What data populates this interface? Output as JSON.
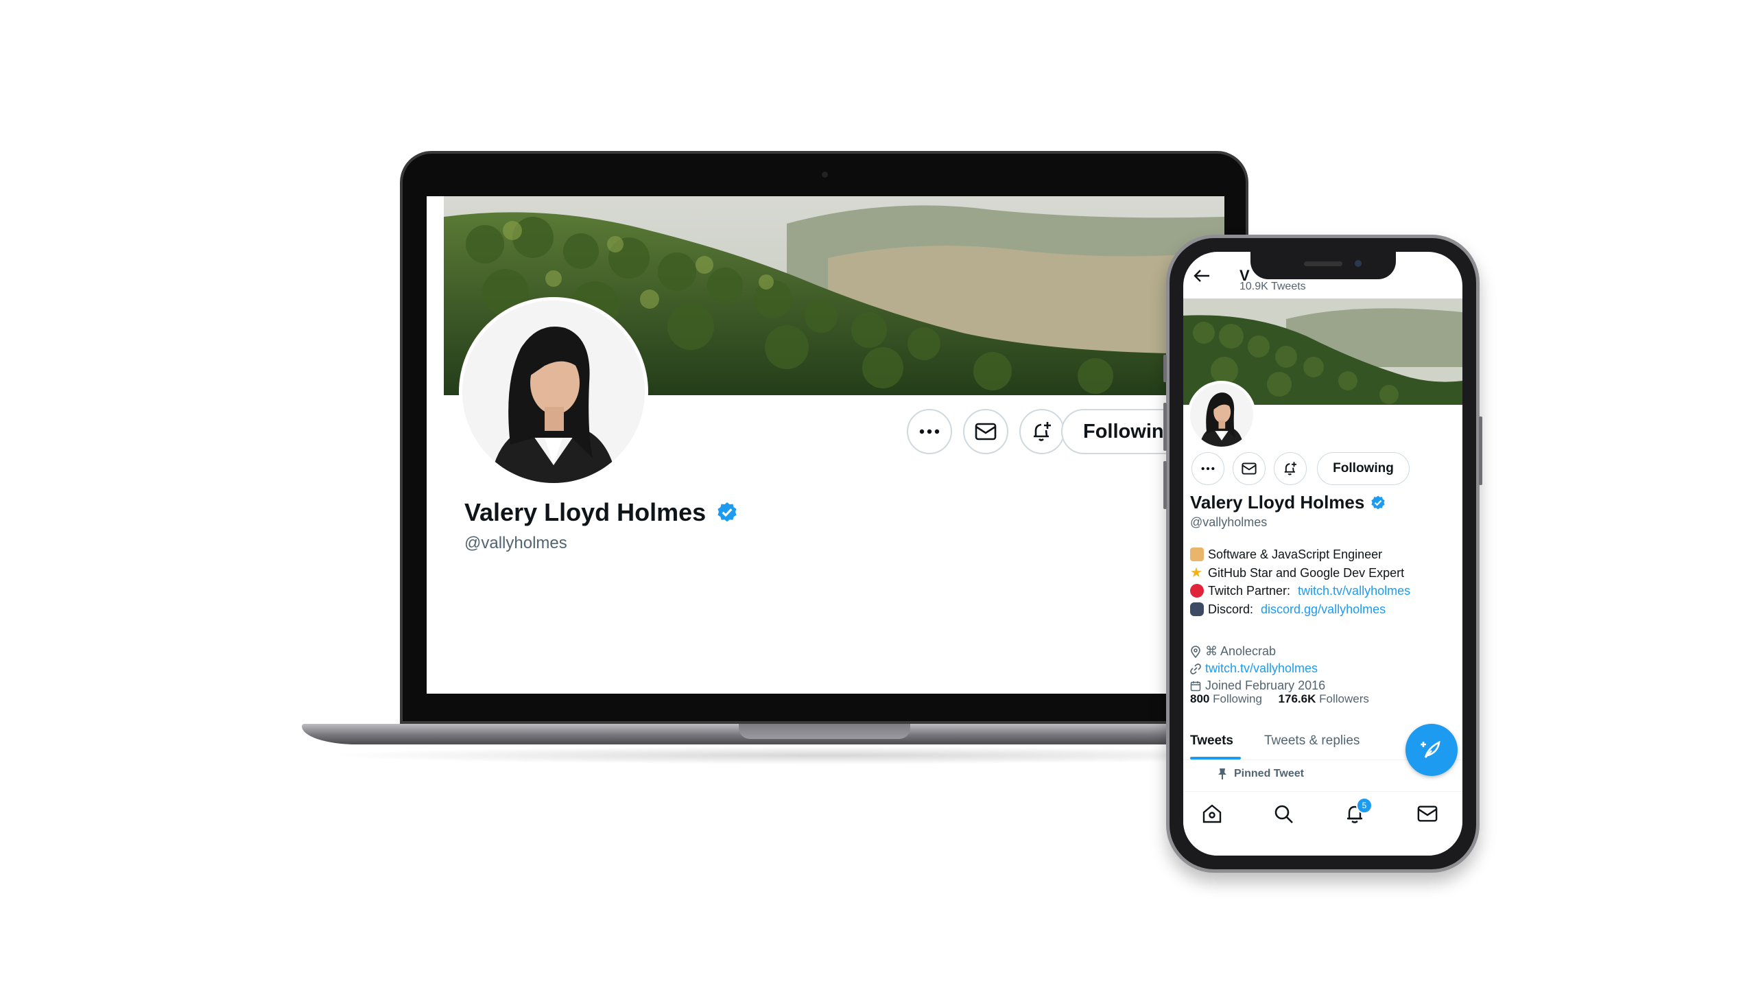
{
  "colors": {
    "accent": "#1d9bf0",
    "text_primary": "#0f1419",
    "text_secondary": "#536471",
    "border": "#cfd9de"
  },
  "profile": {
    "name": "Valery Lloyd Holmes",
    "handle": "@vallyholmes",
    "verified_icon": "verified-badge-icon",
    "following_label": "Following"
  },
  "laptop": {
    "more_icon": "more-dots-icon",
    "message_icon": "mail-icon",
    "notify_icon": "bell-plus-icon",
    "following_label": "Following"
  },
  "phone": {
    "header": {
      "title_fragment": "V",
      "tweets_count": "10.9K Tweets",
      "back_icon": "back-arrow-icon"
    },
    "bio": {
      "line1": "Software & JavaScript Engineer",
      "line2": "GitHub Star and Google Dev Expert",
      "line3_label": "Twitch Partner: ",
      "line3_link": "twitch.tv/vallyholmes",
      "line4_label": "Discord: ",
      "line4_link": "discord.gg/vallyholmes"
    },
    "meta": {
      "location": "⌘ Anolecrab",
      "website": "twitch.tv/vallyholmes",
      "joined": "Joined February 2016"
    },
    "stats": {
      "following_count": "800",
      "following_label": "Following",
      "followers_count": "176.6K",
      "followers_label": "Followers"
    },
    "tabs": [
      {
        "label": "Tweets",
        "active": true
      },
      {
        "label": "Tweets & replies",
        "active": false
      }
    ],
    "pinned_label": "Pinned Tweet",
    "nav": {
      "home_icon": "home-icon",
      "search_icon": "search-icon",
      "notifications_icon": "bell-icon",
      "notifications_badge": "5",
      "messages_icon": "mail-icon"
    },
    "compose_icon": "compose-feather-icon"
  }
}
